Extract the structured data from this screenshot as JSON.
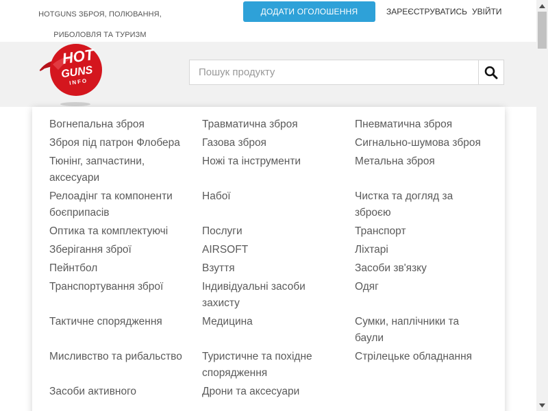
{
  "header": {
    "tagline": "HOTGUNS ЗБРОЯ, ПОЛЮВАННЯ, РИБОЛОВЛЯ ТА ТУРИЗМ",
    "add_button": "ДОДАТИ ОГОЛОШЕННЯ",
    "register_link": "ЗАРЕЄСТРУВАТИСЬ",
    "login_link": "УВІЙТИ"
  },
  "logo": {
    "line1": "HOT",
    "line2": "GUNS",
    "line3": "INFO"
  },
  "search": {
    "placeholder": "Пошук продукту",
    "value": ""
  },
  "menu": {
    "items": [
      "Вогнепальна зброя",
      "Травматична зброя",
      "Пневматична зброя",
      "Зброя під патрон Флобера",
      "Газова зброя",
      "Сигнально-шумова зброя",
      "Тюнінг, запчастини, аксесуари",
      "Ножі та інструменти",
      "Метальна зброя",
      "Релоадінг та компоненти боєприпасів",
      "Набої",
      "Чистка та догляд за зброєю",
      "Оптика та комплектуючі",
      "Послуги",
      "Транспорт",
      "Зберігання зброї",
      "AIRSOFT",
      "Ліхтарі",
      "Пейнтбол",
      "Взуття",
      "Засоби зв'язку",
      "Транспортування зброї",
      "Індивідуальні засоби захисту",
      "Одяг",
      "Тактичне спорядження",
      "Медицина",
      "Сумки, наплічники та баули",
      "Мисливство та рибальство",
      "Туристичне та похідне спорядження",
      "Стрілецьке обладнання",
      "Засоби активного",
      "Дрони та аксесуари",
      ""
    ]
  },
  "colors": {
    "accent": "#2ea1d8",
    "logo_red": "#d4161e",
    "header_bg": "#f1f1f1"
  }
}
